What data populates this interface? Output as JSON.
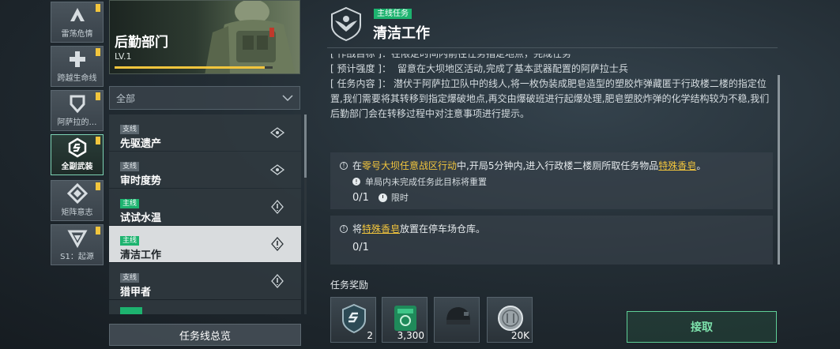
{
  "factions": [
    {
      "label": "雷荡危情",
      "icon": "warning-a-icon",
      "flag": true,
      "active": false
    },
    {
      "label": "跨越生命线",
      "icon": "cross-icon",
      "flag": true,
      "active": false
    },
    {
      "label": "阿萨拉的…",
      "icon": "shield-v-icon",
      "flag": true,
      "active": false
    },
    {
      "label": "全副武装",
      "icon": "hex-s-icon",
      "flag": true,
      "active": true
    },
    {
      "label": "矩阵意志",
      "icon": "diamond-icon",
      "flag": true,
      "active": false
    },
    {
      "label": "S1：起源",
      "icon": "triangle-v-icon",
      "flag": true,
      "active": false
    }
  ],
  "department": {
    "name": "后勤部门",
    "level": "LV.1",
    "progress": 0.95
  },
  "filter": {
    "selected": "全部"
  },
  "quests": [
    {
      "tag": "支线",
      "name": "先驱遗产",
      "main": false,
      "icon": "eye-scan-icon"
    },
    {
      "tag": "支线",
      "name": "审时度势",
      "main": false,
      "icon": "eye-scan-icon"
    },
    {
      "tag": "主线",
      "name": "试试水温",
      "main": true,
      "icon": "target-icon"
    },
    {
      "tag": "主线",
      "name": "清洁工作",
      "main": true,
      "icon": "target-icon",
      "selected": true
    },
    {
      "tag": "支线",
      "name": "猎甲者",
      "main": false,
      "icon": "target-icon"
    },
    {
      "tag": "主线",
      "name": "",
      "main": true,
      "icon": ""
    }
  ],
  "overview_label": "任务线总览",
  "detail": {
    "badge": "主线任务",
    "title": "清洁工作",
    "cut_line": "[ 作战目标 ]：在限定时间内前往任务指定地点，完成任务",
    "strength_key": "[ 预计强度 ]：",
    "strength": "留意在大坝地区活动,完成了基本武器配置的阿萨拉士兵",
    "content_key": "[ 任务内容 ]：",
    "content": "潜伏于阿萨拉卫队中的线人,将一枚伪装成肥皂造型的塑胶炸弹藏匿于行政楼二楼的指定位置,我们需要将其转移到指定爆破地点,再交由爆破班进行起爆处理,肥皂塑胶炸弹的化学结构较为不稳,我们后勤部门会在转移过程中对注意事项进行提示。"
  },
  "objective1": {
    "pre": "在",
    "zone": "零号大坝任意战区行动",
    "mid": "中,开局5分钟内,进入行政楼二楼厕所取任务物品",
    "item": "特殊香皂",
    "post": "。",
    "note": "单局内未完成任务此目标将重置",
    "progress": "0/1",
    "limit": "限时"
  },
  "objective2": {
    "pre": "将",
    "item": "特殊香皂",
    "post": "放置在停车场仓库。",
    "progress": "0/1"
  },
  "rewards_title": "任务奖励",
  "rewards": [
    {
      "icon": "hex-s-shield-icon",
      "count": "2"
    },
    {
      "icon": "green-cash-icon",
      "count": "3,300"
    },
    {
      "icon": "helmet-icon",
      "count": ""
    },
    {
      "icon": "silver-coin-icon",
      "count": "20K"
    }
  ],
  "claim_label": "接取",
  "colors": {
    "main_green": "#1db36f",
    "accent_gold": "#f2c53d",
    "claim_green": "#7ee3ad"
  }
}
